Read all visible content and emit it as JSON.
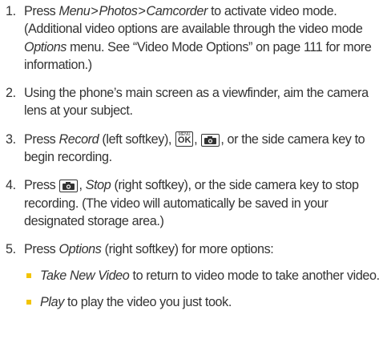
{
  "steps": [
    {
      "num": "1.",
      "a": "Press ",
      "menu": "Menu",
      "gt1": ">",
      "photos": "Photos",
      "gt2": ">",
      "camcorder": "Camcorder",
      "b": " to activate video mode. (Additional video options are available through the video mode ",
      "options": "Options",
      "c": " menu. See “Video Mode Options” on page 111 for more information.)"
    },
    {
      "num": "2.",
      "text": "Using the phone’s main screen as a viewfinder, aim the camera lens at your subject."
    },
    {
      "num": "3.",
      "a": "Press ",
      "record": "Record",
      "b": " (left softkey), ",
      "c": ", ",
      "d": ", or the side camera key to begin recording."
    },
    {
      "num": "4.",
      "a": "Press ",
      "b": ", ",
      "stop": "Stop",
      "c": " (right softkey), or the side camera key to stop recording. (The video will automatically be saved in your designated storage area.)"
    },
    {
      "num": "5.",
      "a": "Press ",
      "options": "Options",
      "b": " (right softkey) for more options:",
      "sub": [
        {
          "label": "Take New Video",
          "text": " to return to video mode to take another video."
        },
        {
          "label": "Play",
          "text": " to play the video you just took."
        }
      ]
    }
  ],
  "keys": {
    "menu_ok_top": "MENU",
    "menu_ok_bottom": "OK"
  },
  "icons": {
    "menu_ok": "menu-ok-key-icon",
    "camera": "camera-key-icon",
    "bullet": "square-bullet"
  },
  "colors": {
    "text": "#333333",
    "bullet": "#f3c400"
  }
}
